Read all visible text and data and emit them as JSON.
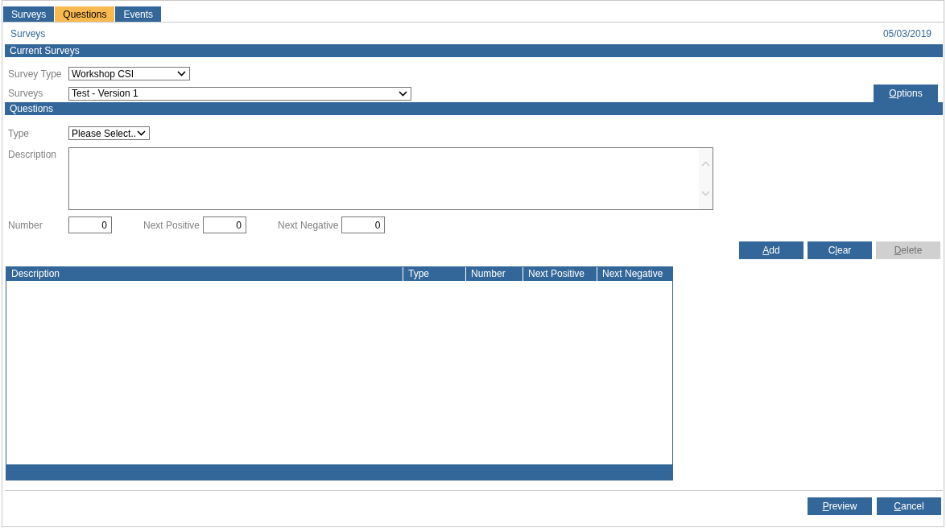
{
  "tabs": [
    {
      "label": "Surveys",
      "selected": false
    },
    {
      "label": "Questions",
      "selected": true
    },
    {
      "label": "Events",
      "selected": false
    }
  ],
  "page_title": "Surveys",
  "date": "05/03/2019",
  "current_surveys": {
    "title": "Current Surveys",
    "survey_type": {
      "label": "Survey Type",
      "value": "Workshop CSI"
    },
    "surveys": {
      "label": "Surveys",
      "value": "Test - Version 1"
    },
    "options_button": {
      "label": {
        "key": "O",
        "after": "ptions"
      },
      "disabled": false
    }
  },
  "questions": {
    "title": "Questions",
    "type": {
      "label": "Type",
      "value": "Please Select.."
    },
    "description": {
      "label": "Description"
    },
    "number": {
      "label": "Number",
      "value": "0"
    },
    "next_positive": {
      "label": "Next Positive",
      "value": "0"
    },
    "next_negative": {
      "label": "Next Negative",
      "value": "0"
    },
    "buttons": [
      {
        "label": {
          "key": "A",
          "after": "dd"
        },
        "disabled": false
      },
      {
        "label": {
          "before": "C",
          "key": "l",
          "after": "ear"
        },
        "disabled": false
      },
      {
        "label": {
          "key": "D",
          "after": "elete"
        },
        "disabled": true
      }
    ]
  },
  "table": {
    "columns": [
      "Description",
      "Type",
      "Number",
      "Next Positive",
      "Next Negative"
    ]
  },
  "footer_buttons": [
    {
      "label": {
        "key": "P",
        "after": "review"
      },
      "disabled": false
    },
    {
      "label": {
        "key": "C",
        "after": "ancel"
      },
      "disabled": false
    }
  ]
}
